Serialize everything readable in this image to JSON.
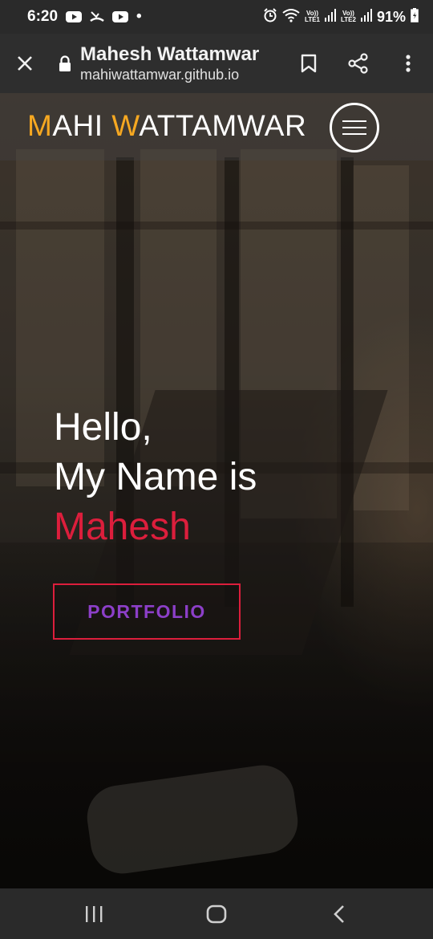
{
  "status": {
    "time": "6:20",
    "dot": "•",
    "sim1": "Vo))",
    "sim1_sub": "LTE1",
    "sim2": "Vo))",
    "sim2_sub": "LTE2",
    "battery": "91%",
    "left_icons": [
      "youtube-icon",
      "missed-call-icon",
      "youtube-icon"
    ],
    "right_icons": [
      "alarm-icon",
      "wifi-icon",
      "signal-icon",
      "signal-icon",
      "battery-icon"
    ]
  },
  "browser": {
    "title": "Mahesh Wattamwar",
    "url": "mahiwattamwar.github.io",
    "icons": [
      "close-icon",
      "lock-icon",
      "bookmark-icon",
      "share-icon",
      "more-vertical-icon"
    ]
  },
  "site": {
    "brand_m": "M",
    "brand_ahi": "AHI ",
    "brand_w": "W",
    "brand_attamwar": "ATTAMWAR",
    "menu_icon": "hamburger-menu-icon",
    "accent_color": "#f6a821"
  },
  "hero": {
    "line1": "Hello,",
    "line2": "My Name is",
    "name": "Mahesh",
    "name_color": "#dc1e3c",
    "button_label": "PORTFOLIO",
    "button_text_color": "#8c3fc8",
    "button_border_color": "#dc1e3c"
  },
  "navigation": {
    "icons": [
      "recent-apps-icon",
      "home-icon",
      "back-icon"
    ]
  }
}
